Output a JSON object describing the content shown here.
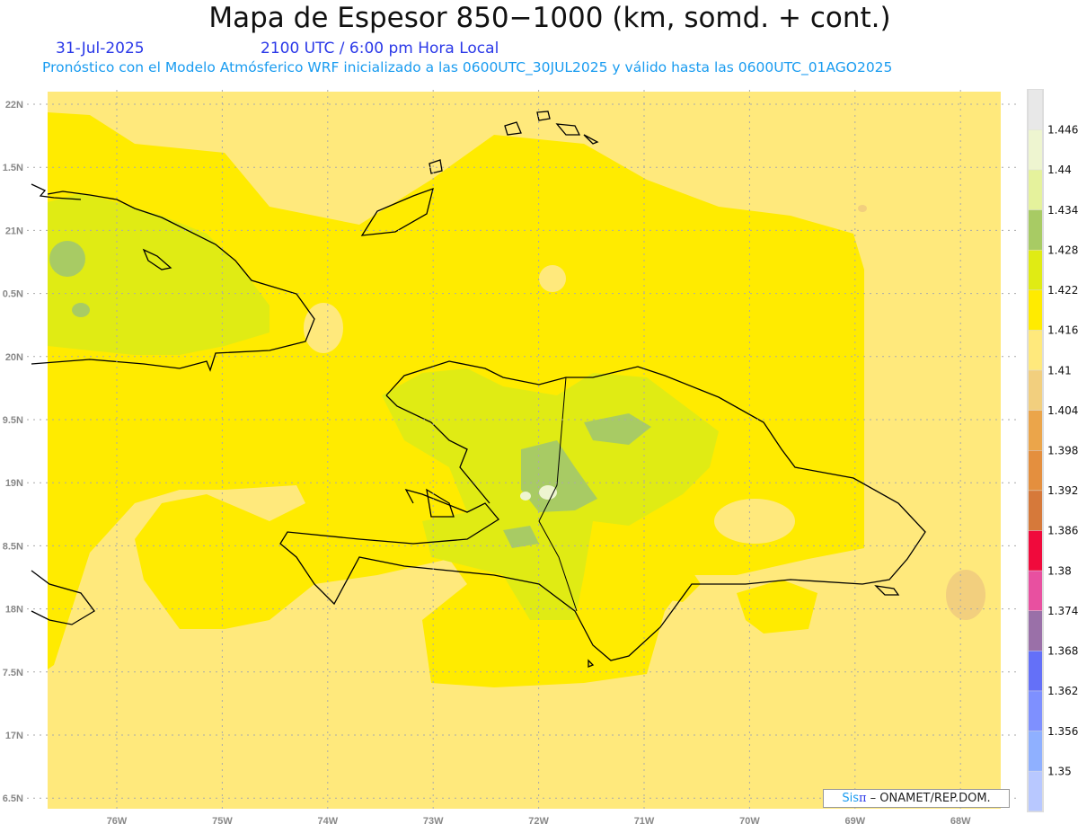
{
  "header": {
    "title": "Mapa de Espesor 850−1000 (km, somd. + cont.)",
    "date": "31-Jul-2025",
    "time": "2100 UTC / 6:00 pm Hora Local",
    "subtitle": "Pronóstico con el Modelo Atmósferico WRF inicializado a las 0600UTC_30JUL2025 y válido hasta las  0600UTC_01AGO2025"
  },
  "map": {
    "lat_labels": [
      "22N",
      "1.5N",
      "21N",
      "0.5N",
      "20N",
      "9.5N",
      "19N",
      "8.5N",
      "18N",
      "7.5N",
      "17N",
      "6.5N"
    ],
    "lon_labels": [
      "76W",
      "75W",
      "74W",
      "73W",
      "72W",
      "71W",
      "70W",
      "69W",
      "68W"
    ]
  },
  "colorbar": {
    "labels": [
      "1.446",
      "1.44",
      "1.434",
      "1.428",
      "1.422",
      "1.416",
      "1.41",
      "1.404",
      "1.398",
      "1.392",
      "1.386",
      "1.38",
      "1.374",
      "1.368",
      "1.362",
      "1.356",
      "1.35"
    ],
    "colors": [
      "#e8e8e8",
      "#eef5d0",
      "#e5f29c",
      "#a8cb64",
      "#e0eb14",
      "#ffeb00",
      "#ffe97c",
      "#f2cf7e",
      "#eba54a",
      "#e48f3e",
      "#d6793a",
      "#f00a3c",
      "#e850a0",
      "#9a70a8",
      "#6470f8",
      "#7e90ff",
      "#8fb0ff",
      "#b8c8ff"
    ]
  },
  "credit": {
    "sis": "Sis",
    "pi": "π",
    "rest": " – ONAMET/REP.DOM."
  }
}
